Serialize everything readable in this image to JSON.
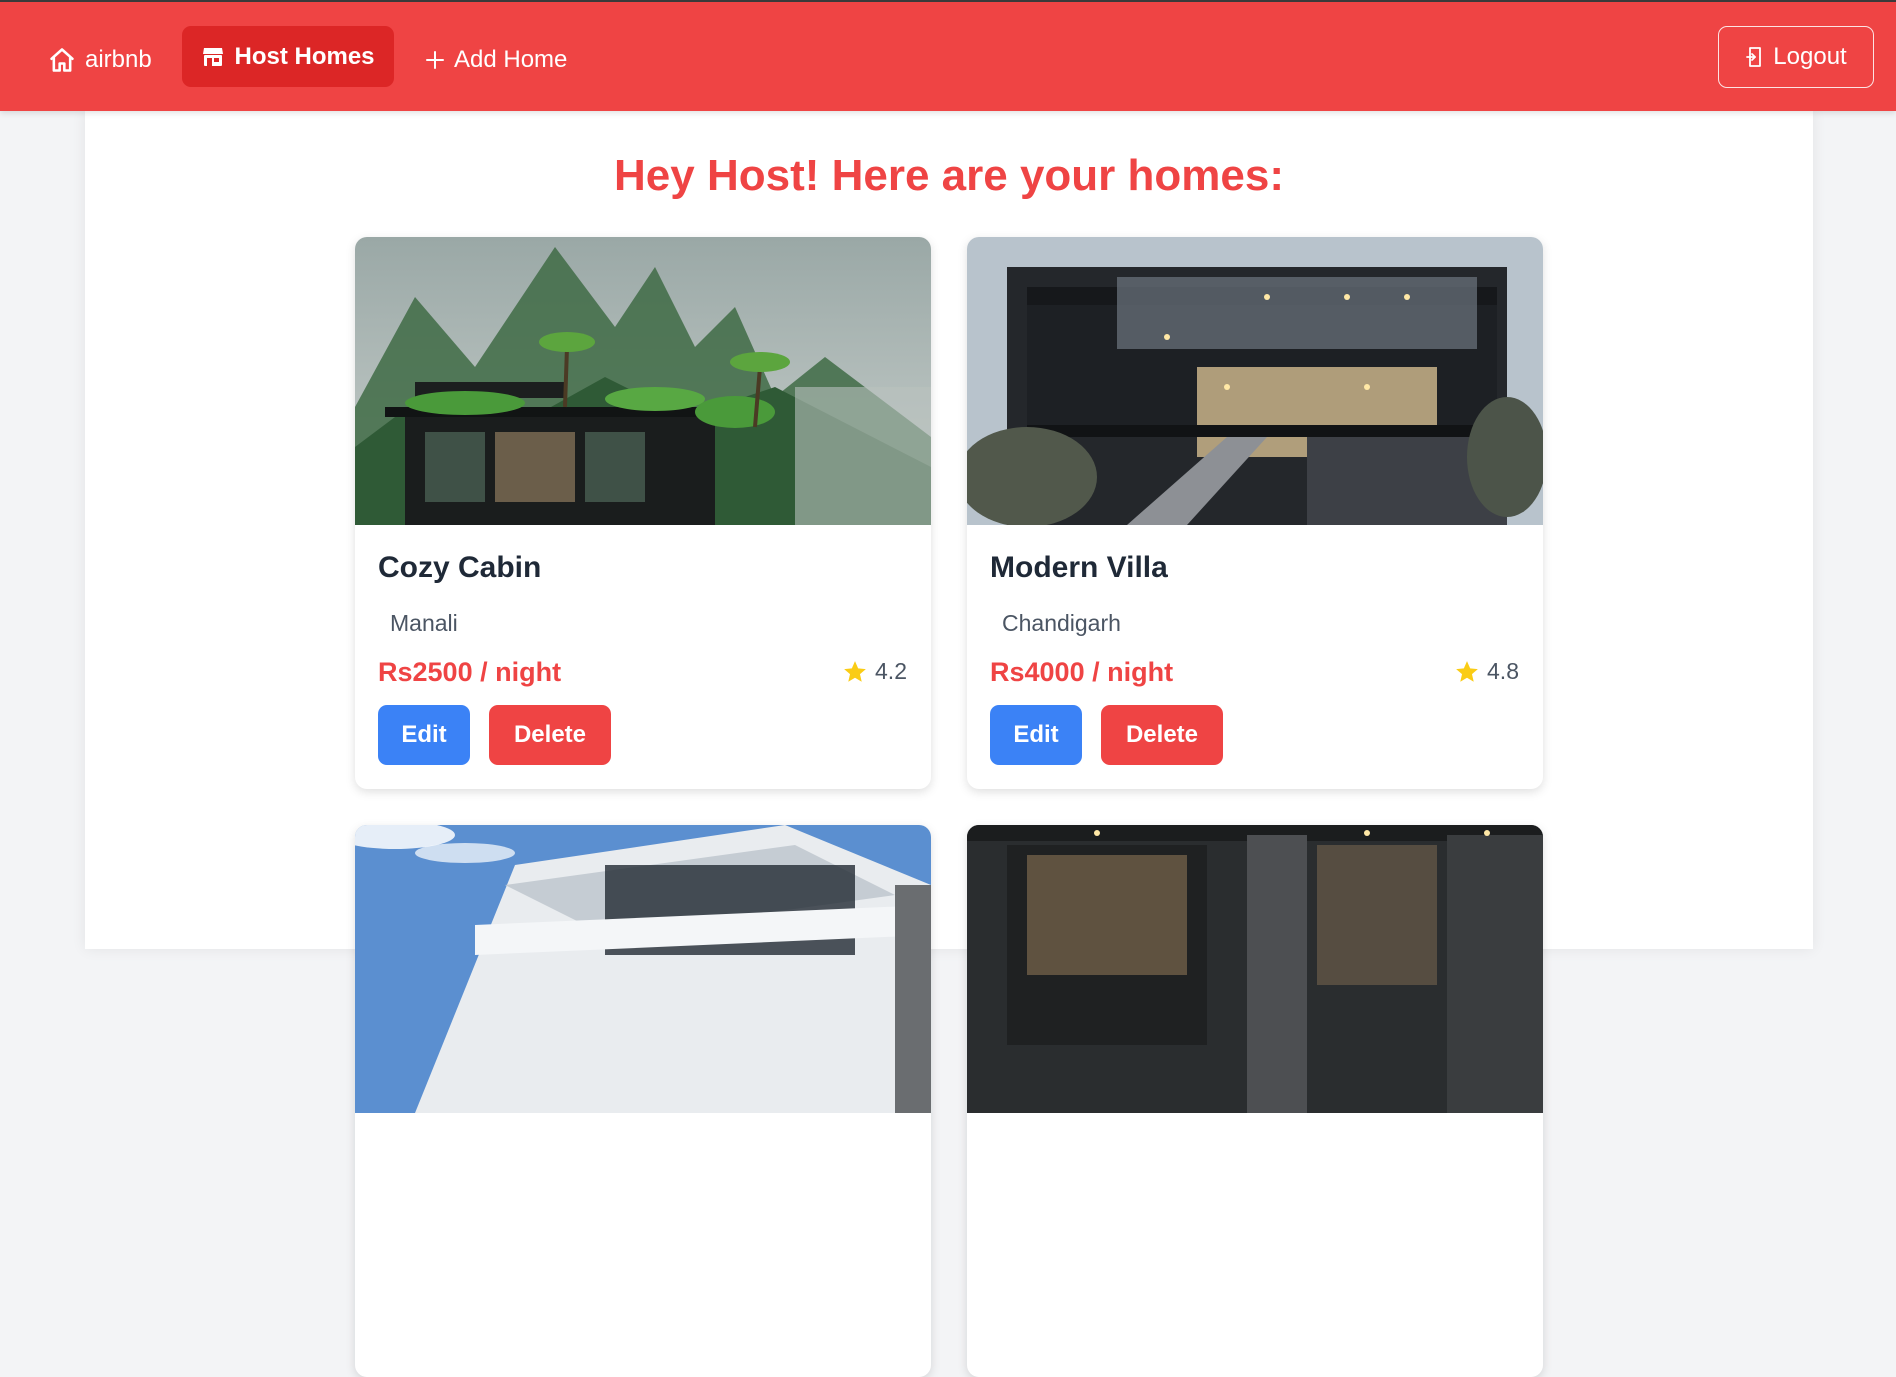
{
  "nav": {
    "brand": "airbnb",
    "host_homes": "Host Homes",
    "add_home": "Add Home",
    "logout": "Logout"
  },
  "page": {
    "title": "Hey Host! Here are your homes:"
  },
  "homes": [
    {
      "name": "Cozy Cabin",
      "location": "Manali",
      "price": "Rs2500 / night",
      "rating": "4.2",
      "edit_label": "Edit",
      "delete_label": "Delete"
    },
    {
      "name": "Modern Villa",
      "location": "Chandigarh",
      "price": "Rs4000 / night",
      "rating": "4.8",
      "edit_label": "Edit",
      "delete_label": "Delete"
    },
    {},
    {}
  ],
  "icons": {
    "brand": "home-icon",
    "host_homes": "store-icon",
    "add_home": "plus-icon",
    "logout": "logout-icon",
    "rating": "star-icon"
  },
  "colors": {
    "primary": "#ef4444",
    "primary_dark": "#dc2626",
    "edit_button": "#3b82f6",
    "star": "#facc15"
  }
}
